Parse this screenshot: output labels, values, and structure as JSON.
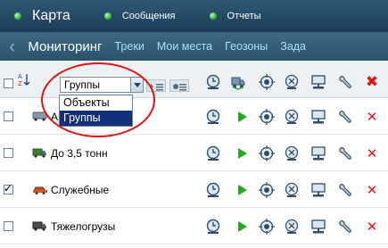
{
  "topbar": {
    "items": [
      {
        "label": "Карта"
      },
      {
        "label": "Сообщения"
      },
      {
        "label": "Отчеты"
      }
    ]
  },
  "navbar": {
    "current": "Мониторинг",
    "links": [
      "Треки",
      "Мои места",
      "Геозоны",
      "Зада"
    ]
  },
  "toolbar": {
    "group_select_value": "Группы",
    "dropdown_options": [
      "Объекты",
      "Группы"
    ],
    "dropdown_selected": "Группы"
  },
  "rows": [
    {
      "name": "Автобусы",
      "checked": false
    },
    {
      "name": "До 3,5 тонн",
      "checked": false
    },
    {
      "name": "Служебные",
      "checked": true
    },
    {
      "name": "Тяжелогрузы",
      "checked": false
    }
  ],
  "colors": {
    "topbar": "#1c3d56",
    "navbar": "#2a526d",
    "nav_link": "#a9e2f5",
    "highlight": "#e01616",
    "dropdown_active": "#12307a",
    "play_green": "#1bb01b"
  },
  "icons": [
    "sort-az-icon",
    "list-icon",
    "list-alt-icon",
    "clock-icon",
    "truck-icon",
    "play-icon",
    "locate-icon",
    "satellite-icon",
    "computer-icon",
    "wrench-icon",
    "close-icon"
  ]
}
